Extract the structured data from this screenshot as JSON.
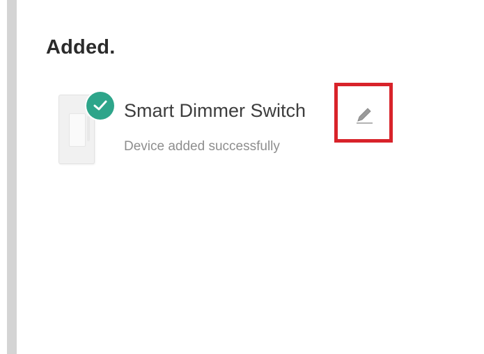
{
  "page": {
    "section_title": "Added."
  },
  "device": {
    "name": "Smart Dimmer Switch",
    "status": "Device added successfully",
    "thumbnail_icon": "dimmer-switch-icon",
    "badge_icon": "check-icon",
    "edit_icon": "pencil-icon"
  },
  "colors": {
    "badge_green": "#2ea58a",
    "highlight_red": "#d8232a",
    "title_text": "#2b2b2b",
    "name_text": "#3d3d3d",
    "status_text": "#8e8e8e",
    "left_bar": "#d4d4d4"
  }
}
